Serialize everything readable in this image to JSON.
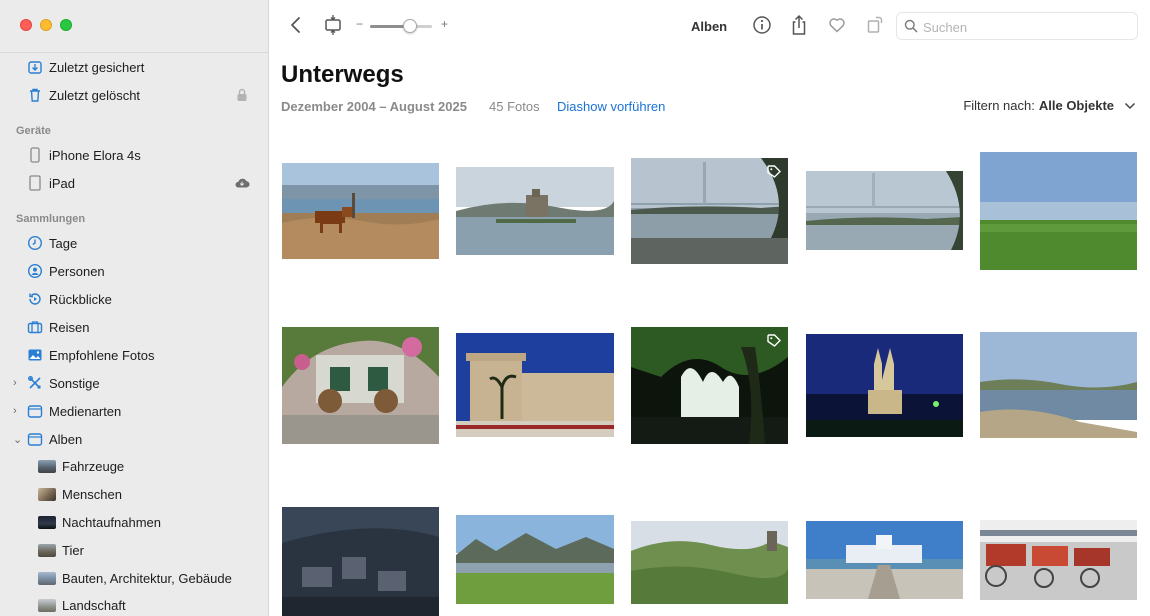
{
  "sidebar": {
    "top_items": [
      {
        "label": "Zuletzt gesichert",
        "icon": "backup-icon"
      },
      {
        "label": "Zuletzt gelöscht",
        "icon": "trash-icon",
        "trailing": "lock-icon"
      }
    ],
    "devices_header": "Geräte",
    "devices": [
      {
        "label": "iPhone Elora 4s",
        "icon": "iphone-icon"
      },
      {
        "label": "iPad",
        "icon": "ipad-icon",
        "trailing": "cloud-icon"
      }
    ],
    "collections_header": "Sammlungen",
    "collections": [
      {
        "label": "Tage",
        "icon": "clock-icon"
      },
      {
        "label": "Personen",
        "icon": "person-icon"
      },
      {
        "label": "Rückblicke",
        "icon": "memories-icon"
      },
      {
        "label": "Reisen",
        "icon": "suitcase-icon"
      },
      {
        "label": "Empfohlene Fotos",
        "icon": "photo-icon"
      },
      {
        "label": "Sonstige",
        "icon": "tools-icon",
        "chevron": "›"
      },
      {
        "label": "Medienarten",
        "icon": "folder-icon",
        "chevron": "›"
      },
      {
        "label": "Alben",
        "icon": "folder-icon",
        "chevron": "⌄"
      }
    ],
    "albums": [
      {
        "label": "Fahrzeuge"
      },
      {
        "label": "Menschen"
      },
      {
        "label": "Nachtaufnahmen"
      },
      {
        "label": "Tier"
      },
      {
        "label": "Bauten, Architektur, Gebäude"
      },
      {
        "label": "Landschaft"
      }
    ]
  },
  "toolbar": {
    "zoom_minus": "−",
    "zoom_plus": "+",
    "zoom_level": 0.65,
    "albums_label": "Alben",
    "search_placeholder": "Suchen"
  },
  "album": {
    "title": "Unterwegs",
    "date_range": "Dezember 2004 – August 2025",
    "count": "45 Fotos",
    "slideshow": "Diashow vorführen",
    "filter_label": "Filtern nach:",
    "filter_value": "Alle Objekte"
  },
  "colors": {
    "accent": "#1a73d6",
    "sidebar_icon": "#2a7fd4"
  }
}
